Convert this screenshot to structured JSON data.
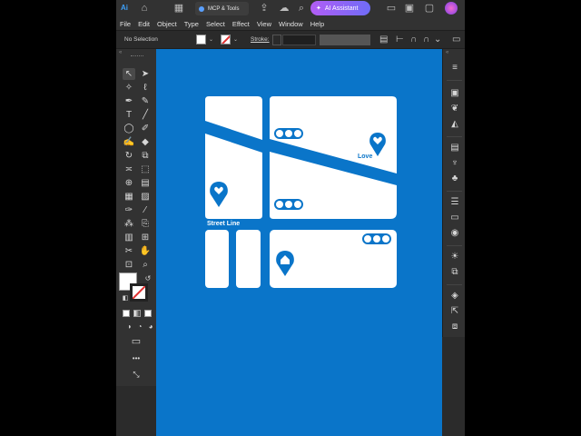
{
  "titlebar": {
    "app_logo": "Ai",
    "mcp_button": "MCP & Tools",
    "ai_assistant": "AI Assistant",
    "icons": [
      "home-icon",
      "share-icon",
      "search-icon",
      "minimize-icon",
      "maximize-icon",
      "close-icon"
    ]
  },
  "menu": [
    "File",
    "Edit",
    "Object",
    "Type",
    "Select",
    "Effect",
    "View",
    "Window",
    "Help"
  ],
  "control_bar": {
    "selection_status": "No Selection",
    "stroke_label": "Stroke:",
    "stroke_value": ""
  },
  "toolbar": {
    "header": "«",
    "tools": [
      "selection-tool",
      "direct-selection-tool",
      "magic-wand-tool",
      "lasso-tool",
      "pen-tool",
      "curvature-tool",
      "type-tool",
      "line-tool",
      "rectangle-tool",
      "paintbrush-tool",
      "shaper-tool",
      "eraser-tool",
      "rotate-tool",
      "scale-tool",
      "width-tool",
      "free-transform-tool",
      "shape-builder-tool",
      "perspective-tool",
      "mesh-tool",
      "gradient-tool",
      "eyedropper-tool",
      "blend-tool",
      "symbol-sprayer-tool",
      "artboard-tool",
      "column-graph-tool",
      "slice-tool",
      "hand-tool",
      "zoom-tool"
    ],
    "more": "•••"
  },
  "artwork": {
    "labels": {
      "love": "Love",
      "street_line": "Street Line"
    },
    "colors": {
      "background": "#0a75c9",
      "shapes": "#ffffff"
    }
  },
  "right_panel": {
    "header": "«",
    "icons": [
      "properties-icon",
      "libraries-icon",
      "layers-icon",
      "color-icon",
      "swatches-icon",
      "brushes-icon",
      "symbols-icon",
      "stroke-icon",
      "gradient-icon",
      "transparency-icon",
      "appearance-icon",
      "graphic-styles-icon",
      "align-icon",
      "transform-icon",
      "pathfinder-icon"
    ]
  }
}
